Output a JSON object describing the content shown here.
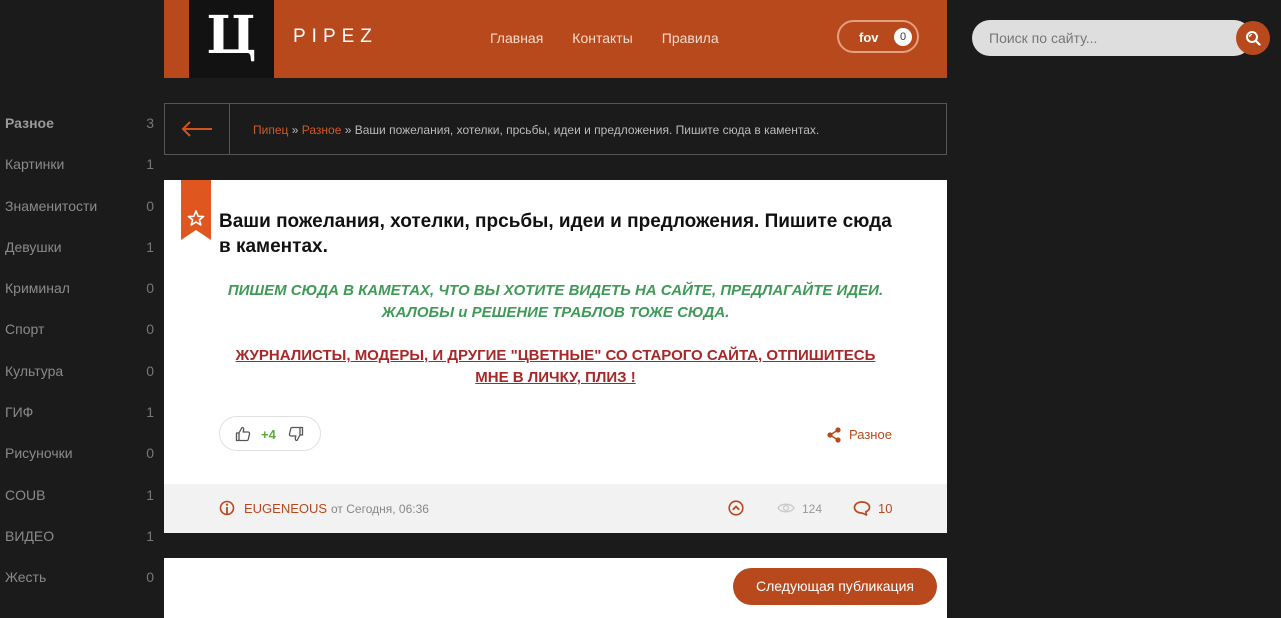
{
  "header": {
    "logo": "Ц",
    "site_name": "PIPEZ",
    "nav": [
      "Главная",
      "Контакты",
      "Правила"
    ],
    "fav_label": "fov",
    "fav_count": "0"
  },
  "search": {
    "placeholder": "Поиск по сайту..."
  },
  "sidebar": {
    "categories": [
      {
        "name": "Разное",
        "count": "3"
      },
      {
        "name": "Картинки",
        "count": "1"
      },
      {
        "name": "Знаменитости",
        "count": "0"
      },
      {
        "name": "Девушки",
        "count": "1"
      },
      {
        "name": "Криминал",
        "count": "0"
      },
      {
        "name": "Спорт",
        "count": "0"
      },
      {
        "name": "Культура",
        "count": "0"
      },
      {
        "name": "ГИФ",
        "count": "1"
      },
      {
        "name": "Рисуночки",
        "count": "0"
      },
      {
        "name": "COUB",
        "count": "1"
      },
      {
        "name": "ВИДЕО",
        "count": "1"
      },
      {
        "name": "Жесть",
        "count": "0"
      }
    ]
  },
  "breadcrumb": {
    "home": "Пипец",
    "sep": "»",
    "category": "Разное",
    "current": "Ваши пожелания, хотелки, прсьбы, идеи и предложения. Пишите сюда в каментах."
  },
  "post": {
    "title": "Ваши пожелания, хотелки, прсьбы, идеи и предложения. Пишите сюда в каментах.",
    "green_line1": "ПИШЕМ СЮДА В КАМЕТАХ, ЧТО ВЫ ХОТИТЕ ВИДЕТЬ НА САЙТЕ, ПРЕДЛАГАЙТЕ ИДЕИ.",
    "green_line2": "ЖАЛОБЫ и РЕШЕНИЕ ТРАБЛОВ ТОЖЕ СЮДА.",
    "red_line1": "ЖУРНАЛИСТЫ, МОДЕРЫ, И ДРУГИЕ \"ЦВЕТНЫЕ\" СО СТАРОГО САЙТА, ОТПИШИТЕСЬ",
    "red_line2": "МНЕ В ЛИЧКУ, ПЛИЗ !",
    "rating": "+4",
    "category": "Разное",
    "author": "EUGENEOUS",
    "date": "от Сегодня, 06:36",
    "views": "124",
    "comments": "10"
  },
  "next_button": "Следующая публикация",
  "colors": {
    "accent": "#b8491c",
    "background": "#1b1b1b",
    "green_text": "#3f9a57",
    "red_text": "#a62828"
  }
}
